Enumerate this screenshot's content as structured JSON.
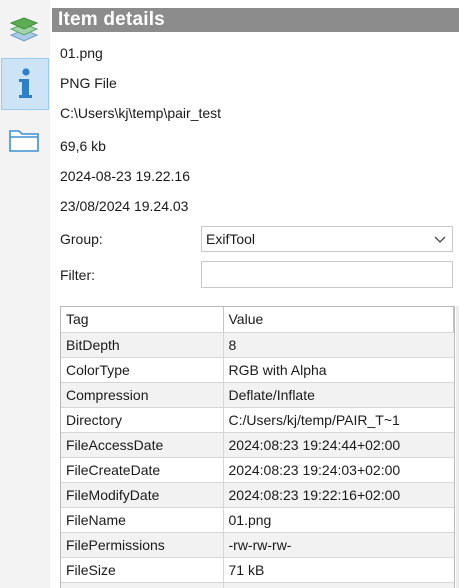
{
  "header": {
    "title": "Item details"
  },
  "side_tabs": [
    {
      "name": "layers-icon",
      "active": false
    },
    {
      "name": "info-icon",
      "active": true
    },
    {
      "name": "folder-icon",
      "active": false
    }
  ],
  "info": {
    "filename": "01.png",
    "filetype": "PNG File",
    "path": "C:\\Users\\kj\\temp\\pair_test",
    "size": "69,6 kb",
    "modified": "2024-08-23 19.22.16",
    "created": "23/08/2024 19.24.03"
  },
  "form": {
    "group_label": "Group:",
    "group_value": "ExifTool",
    "filter_label": "Filter:",
    "filter_value": ""
  },
  "table": {
    "columns": [
      "Tag",
      "Value"
    ],
    "rows": [
      [
        "BitDepth",
        "8"
      ],
      [
        "ColorType",
        "RGB with Alpha"
      ],
      [
        "Compression",
        "Deflate/Inflate"
      ],
      [
        "Directory",
        "C:/Users/kj/temp/PAIR_T~1"
      ],
      [
        "FileAccessDate",
        "2024:08:23 19:24:44+02:00"
      ],
      [
        "FileCreateDate",
        "2024:08:23 19:24:03+02:00"
      ],
      [
        "FileModifyDate",
        "2024:08:23 19:22:16+02:00"
      ],
      [
        "FileName",
        "01.png"
      ],
      [
        "FilePermissions",
        "-rw-rw-rw-"
      ],
      [
        "FileSize",
        "71 kB"
      ],
      [
        "",
        ""
      ]
    ]
  },
  "colors": {
    "header_bg": "#8c8c8c",
    "active_tab_bg": "#cde4f7",
    "info_icon": "#2f7fc6",
    "folder_icon": "#3d8fd6"
  }
}
